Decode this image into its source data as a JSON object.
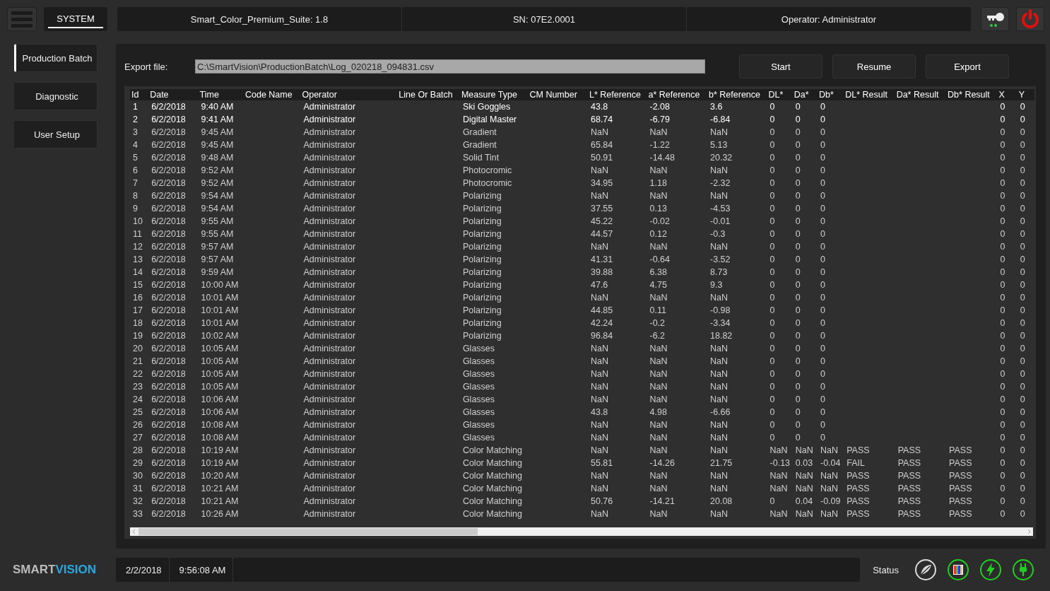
{
  "top_bar": {
    "system_tab": {
      "label": "SYSTEM",
      "selected": true
    },
    "info": [
      "Smart_Color_Premium_Suite: 1.8",
      "SN: 07E2.0001",
      "Operator: Administrator"
    ]
  },
  "sidebar": {
    "items": [
      {
        "label": "Production Batch",
        "selected": true
      },
      {
        "label": "Diagnostic",
        "selected": false
      },
      {
        "label": "User Setup",
        "selected": false
      }
    ]
  },
  "export": {
    "label": "Export file:",
    "value": "C:\\SmartVision\\ProductionBatch\\Log_020218_094831.csv",
    "buttons": [
      "Start",
      "Resume",
      "Export"
    ]
  },
  "table": {
    "columns": [
      "Id",
      "Date",
      "Time",
      "Code Name",
      "Operator",
      "Line Or Batch",
      "Measure Type",
      "CM Number",
      "L* Reference",
      "a* Reference",
      "b* Reference",
      "DL*",
      "Da*",
      "Db*",
      "DL* Result",
      "Da* Result",
      "Db* Result",
      "X",
      "Y"
    ],
    "rows": [
      {
        "selected": true,
        "cells": [
          "1",
          "6/2/2018",
          "9:40 AM",
          null,
          "Administrator",
          null,
          "Ski Goggles",
          null,
          "43.8",
          "-2.08",
          "3.6",
          "0",
          "0",
          "0",
          null,
          null,
          null,
          "0",
          "0"
        ]
      },
      {
        "selected": true,
        "cells": [
          "2",
          "6/2/2018",
          "9:41 AM",
          null,
          "Administrator",
          null,
          "Digital Master",
          null,
          "68.74",
          "-6.79",
          "-6.84",
          "0",
          "0",
          "0",
          null,
          null,
          null,
          "0",
          "0"
        ]
      },
      {
        "selected": false,
        "cells": [
          "3",
          "6/2/2018",
          "9:45 AM",
          null,
          "Administrator",
          null,
          "Gradient",
          null,
          "NaN",
          "NaN",
          "NaN",
          "0",
          "0",
          "0",
          null,
          null,
          null,
          "0",
          "0"
        ]
      },
      {
        "selected": false,
        "cells": [
          "4",
          "6/2/2018",
          "9:45 AM",
          null,
          "Administrator",
          null,
          "Gradient",
          null,
          "65.84",
          "-1.22",
          "5.13",
          "0",
          "0",
          "0",
          null,
          null,
          null,
          "0",
          "0"
        ]
      },
      {
        "selected": false,
        "cells": [
          "5",
          "6/2/2018",
          "9:48 AM",
          null,
          "Administrator",
          null,
          "Solid Tint",
          null,
          "50.91",
          "-14.48",
          "20.32",
          "0",
          "0",
          "0",
          null,
          null,
          null,
          "0",
          "0"
        ]
      },
      {
        "selected": false,
        "cells": [
          "6",
          "6/2/2018",
          "9:52 AM",
          null,
          "Administrator",
          null,
          "Photocromic",
          null,
          "NaN",
          "NaN",
          "NaN",
          "0",
          "0",
          "0",
          null,
          null,
          null,
          "0",
          "0"
        ]
      },
      {
        "selected": false,
        "cells": [
          "7",
          "6/2/2018",
          "9:52 AM",
          null,
          "Administrator",
          null,
          "Photocromic",
          null,
          "34.95",
          "1.18",
          "-2.32",
          "0",
          "0",
          "0",
          null,
          null,
          null,
          "0",
          "0"
        ]
      },
      {
        "selected": false,
        "cells": [
          "8",
          "6/2/2018",
          "9:54 AM",
          null,
          "Administrator",
          null,
          "Polarizing",
          null,
          "NaN",
          "NaN",
          "NaN",
          "0",
          "0",
          "0",
          null,
          null,
          null,
          "0",
          "0"
        ]
      },
      {
        "selected": false,
        "cells": [
          "9",
          "6/2/2018",
          "9:54 AM",
          null,
          "Administrator",
          null,
          "Polarizing",
          null,
          "37.55",
          "0.13",
          "-4.53",
          "0",
          "0",
          "0",
          null,
          null,
          null,
          "0",
          "0"
        ]
      },
      {
        "selected": false,
        "cells": [
          "10",
          "6/2/2018",
          "9:55 AM",
          null,
          "Administrator",
          null,
          "Polarizing",
          null,
          "45.22",
          "-0.02",
          "-0.01",
          "0",
          "0",
          "0",
          null,
          null,
          null,
          "0",
          "0"
        ]
      },
      {
        "selected": false,
        "cells": [
          "11",
          "6/2/2018",
          "9:55 AM",
          null,
          "Administrator",
          null,
          "Polarizing",
          null,
          "44.57",
          "0.12",
          "-0.3",
          "0",
          "0",
          "0",
          null,
          null,
          null,
          "0",
          "0"
        ]
      },
      {
        "selected": false,
        "cells": [
          "12",
          "6/2/2018",
          "9:57 AM",
          null,
          "Administrator",
          null,
          "Polarizing",
          null,
          "NaN",
          "NaN",
          "NaN",
          "0",
          "0",
          "0",
          null,
          null,
          null,
          "0",
          "0"
        ]
      },
      {
        "selected": false,
        "cells": [
          "13",
          "6/2/2018",
          "9:57 AM",
          null,
          "Administrator",
          null,
          "Polarizing",
          null,
          "41.31",
          "-0.64",
          "-3.52",
          "0",
          "0",
          "0",
          null,
          null,
          null,
          "0",
          "0"
        ]
      },
      {
        "selected": false,
        "cells": [
          "14",
          "6/2/2018",
          "9:59 AM",
          null,
          "Administrator",
          null,
          "Polarizing",
          null,
          "39.88",
          "6.38",
          "8.73",
          "0",
          "0",
          "0",
          null,
          null,
          null,
          "0",
          "0"
        ]
      },
      {
        "selected": false,
        "cells": [
          "15",
          "6/2/2018",
          "10:00 AM",
          null,
          "Administrator",
          null,
          "Polarizing",
          null,
          "47.6",
          "4.75",
          "9.3",
          "0",
          "0",
          "0",
          null,
          null,
          null,
          "0",
          "0"
        ]
      },
      {
        "selected": false,
        "cells": [
          "16",
          "6/2/2018",
          "10:01 AM",
          null,
          "Administrator",
          null,
          "Polarizing",
          null,
          "NaN",
          "NaN",
          "NaN",
          "0",
          "0",
          "0",
          null,
          null,
          null,
          "0",
          "0"
        ]
      },
      {
        "selected": false,
        "cells": [
          "17",
          "6/2/2018",
          "10:01 AM",
          null,
          "Administrator",
          null,
          "Polarizing",
          null,
          "44.85",
          "0.11",
          "-0.98",
          "0",
          "0",
          "0",
          null,
          null,
          null,
          "0",
          "0"
        ]
      },
      {
        "selected": false,
        "cells": [
          "18",
          "6/2/2018",
          "10:01 AM",
          null,
          "Administrator",
          null,
          "Polarizing",
          null,
          "42.24",
          "-0.2",
          "-3.34",
          "0",
          "0",
          "0",
          null,
          null,
          null,
          "0",
          "0"
        ]
      },
      {
        "selected": false,
        "cells": [
          "19",
          "6/2/2018",
          "10:02 AM",
          null,
          "Administrator",
          null,
          "Polarizing",
          null,
          "96.84",
          "-6.2",
          "18.82",
          "0",
          "0",
          "0",
          null,
          null,
          null,
          "0",
          "0"
        ]
      },
      {
        "selected": false,
        "cells": [
          "20",
          "6/2/2018",
          "10:05 AM",
          null,
          "Administrator",
          null,
          "Glasses",
          null,
          "NaN",
          "NaN",
          "NaN",
          "0",
          "0",
          "0",
          null,
          null,
          null,
          "0",
          "0"
        ]
      },
      {
        "selected": false,
        "cells": [
          "21",
          "6/2/2018",
          "10:05 AM",
          null,
          "Administrator",
          null,
          "Glasses",
          null,
          "NaN",
          "NaN",
          "NaN",
          "0",
          "0",
          "0",
          null,
          null,
          null,
          "0",
          "0"
        ]
      },
      {
        "selected": false,
        "cells": [
          "22",
          "6/2/2018",
          "10:05 AM",
          null,
          "Administrator",
          null,
          "Glasses",
          null,
          "NaN",
          "NaN",
          "NaN",
          "0",
          "0",
          "0",
          null,
          null,
          null,
          "0",
          "0"
        ]
      },
      {
        "selected": false,
        "cells": [
          "23",
          "6/2/2018",
          "10:05 AM",
          null,
          "Administrator",
          null,
          "Glasses",
          null,
          "NaN",
          "NaN",
          "NaN",
          "0",
          "0",
          "0",
          null,
          null,
          null,
          "0",
          "0"
        ]
      },
      {
        "selected": false,
        "cells": [
          "24",
          "6/2/2018",
          "10:06 AM",
          null,
          "Administrator",
          null,
          "Glasses",
          null,
          "NaN",
          "NaN",
          "NaN",
          "0",
          "0",
          "0",
          null,
          null,
          null,
          "0",
          "0"
        ]
      },
      {
        "selected": false,
        "cells": [
          "25",
          "6/2/2018",
          "10:06 AM",
          null,
          "Administrator",
          null,
          "Glasses",
          null,
          "43.8",
          "4.98",
          "-6.66",
          "0",
          "0",
          "0",
          null,
          null,
          null,
          "0",
          "0"
        ]
      },
      {
        "selected": false,
        "cells": [
          "26",
          "6/2/2018",
          "10:08 AM",
          null,
          "Administrator",
          null,
          "Glasses",
          null,
          "NaN",
          "NaN",
          "NaN",
          "0",
          "0",
          "0",
          null,
          null,
          null,
          "0",
          "0"
        ]
      },
      {
        "selected": false,
        "cells": [
          "27",
          "6/2/2018",
          "10:08 AM",
          null,
          "Administrator",
          null,
          "Glasses",
          null,
          "NaN",
          "NaN",
          "NaN",
          "0",
          "0",
          "0",
          null,
          null,
          null,
          "0",
          "0"
        ]
      },
      {
        "selected": false,
        "cells": [
          "28",
          "6/2/2018",
          "10:19 AM",
          null,
          "Administrator",
          null,
          "Color Matching",
          null,
          "NaN",
          "NaN",
          "NaN",
          "NaN",
          "NaN",
          "NaN",
          "PASS",
          "PASS",
          "PASS",
          "0",
          "0"
        ]
      },
      {
        "selected": false,
        "cells": [
          "29",
          "6/2/2018",
          "10:19 AM",
          null,
          "Administrator",
          null,
          "Color Matching",
          null,
          "55.81",
          "-14.26",
          "21.75",
          "-0.13",
          "0.03",
          "-0.04",
          "FAIL",
          "PASS",
          "PASS",
          "0",
          "0"
        ]
      },
      {
        "selected": false,
        "cells": [
          "30",
          "6/2/2018",
          "10:20 AM",
          null,
          "Administrator",
          null,
          "Color Matching",
          null,
          "NaN",
          "NaN",
          "NaN",
          "NaN",
          "NaN",
          "NaN",
          "PASS",
          "PASS",
          "PASS",
          "0",
          "0"
        ]
      },
      {
        "selected": false,
        "cells": [
          "31",
          "6/2/2018",
          "10:21 AM",
          null,
          "Administrator",
          null,
          "Color Matching",
          null,
          "NaN",
          "NaN",
          "NaN",
          "NaN",
          "NaN",
          "NaN",
          "PASS",
          "PASS",
          "PASS",
          "0",
          "0"
        ]
      },
      {
        "selected": false,
        "cells": [
          "32",
          "6/2/2018",
          "10:21 AM",
          null,
          "Administrator",
          null,
          "Color Matching",
          null,
          "50.76",
          "-14.21",
          "20.08",
          "0",
          "0.04",
          "-0.09",
          "PASS",
          "PASS",
          "PASS",
          "0",
          "0"
        ]
      },
      {
        "selected": false,
        "cells": [
          "33",
          "6/2/2018",
          "10:26 AM",
          null,
          "Administrator",
          null,
          "Color Matching",
          null,
          "NaN",
          "NaN",
          "NaN",
          "NaN",
          "NaN",
          "NaN",
          "PASS",
          "PASS",
          "PASS",
          "0",
          "0"
        ]
      }
    ]
  },
  "footer": {
    "logo": {
      "first": "SMART",
      "second": "VISION"
    },
    "date": "2/2/2018",
    "time": "9:56:08 AM",
    "status_label": "Status"
  }
}
